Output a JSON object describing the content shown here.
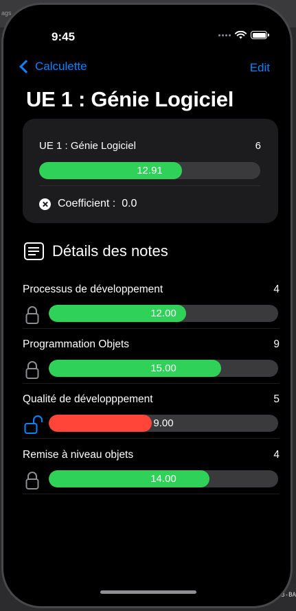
{
  "frame": {
    "top_tag_text": "ags",
    "bottom_fragment_text": "3-BA"
  },
  "status_bar": {
    "time": "9:45"
  },
  "nav": {
    "back_label": "Calculette",
    "edit_label": "Edit"
  },
  "page_title": "UE 1 : Génie Logiciel",
  "summary": {
    "name": "UE 1 : Génie Logiciel",
    "value": "6",
    "grade_text": "12.91",
    "grade_fraction": 0.6455,
    "coefficient_label": "Coefficient :",
    "coefficient_value": "0.0"
  },
  "section": {
    "title": "Détails des notes",
    "icon": "document-list-icon"
  },
  "colors": {
    "accent": "#0a84ff",
    "green": "#30d158",
    "red": "#ff453a",
    "track": "#3a3a3c"
  },
  "grades": [
    {
      "name": "Processus de développement",
      "value": "4",
      "grade_text": "12.00",
      "grade_fraction": 0.6,
      "locked": true
    },
    {
      "name": "Programmation Objets",
      "value": "9",
      "grade_text": "15.00",
      "grade_fraction": 0.75,
      "locked": true
    },
    {
      "name": "Qualité de développpement",
      "value": "5",
      "grade_text": "9.00",
      "grade_fraction": 0.45,
      "locked": false
    },
    {
      "name": "Remise à niveau objets",
      "value": "4",
      "grade_text": "14.00",
      "grade_fraction": 0.7,
      "locked": true
    }
  ]
}
